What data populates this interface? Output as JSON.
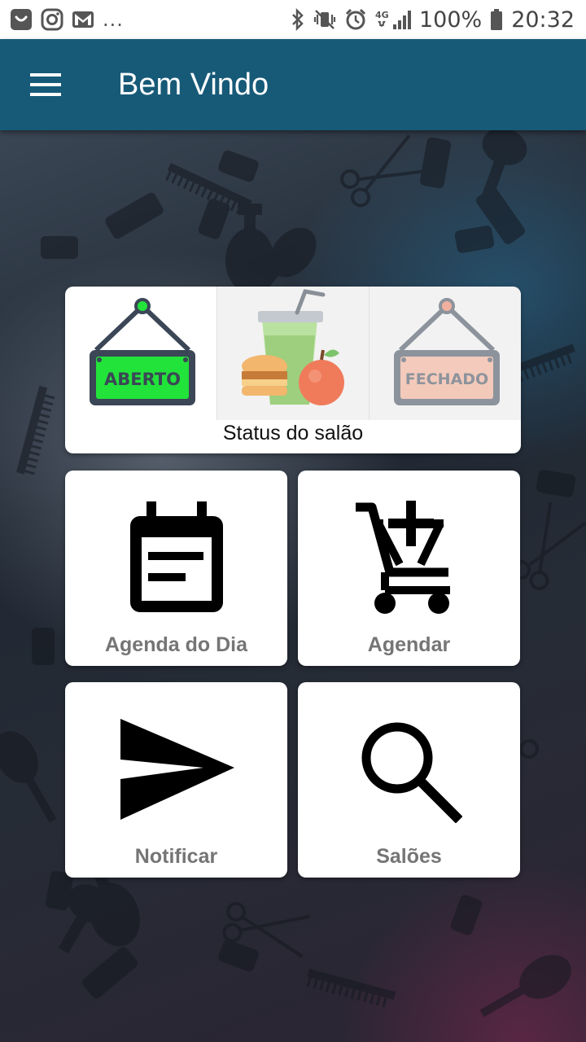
{
  "status_bar": {
    "battery": "100%",
    "time": "20:32",
    "network": "4G",
    "overflow": "..."
  },
  "app_bar": {
    "title": "Bem Vindo",
    "menu_icon": "hamburger-menu-icon"
  },
  "status_card": {
    "label": "Status do salão",
    "open_sign": "ABERTO",
    "closed_sign": "FECHADO",
    "break_icon": "snack-break-icon"
  },
  "tiles": {
    "agenda": {
      "label": "Agenda do Dia",
      "icon": "calendar-icon"
    },
    "agendar": {
      "label": "Agendar",
      "icon": "add-to-cart-icon"
    },
    "notificar": {
      "label": "Notificar",
      "icon": "send-icon"
    },
    "saloes": {
      "label": "Salões",
      "icon": "search-icon"
    }
  },
  "colors": {
    "app_bar": "#175a78",
    "open_sign": "#22e33a",
    "closed_sign": "#f4aa8e",
    "tile_label": "#757575"
  }
}
